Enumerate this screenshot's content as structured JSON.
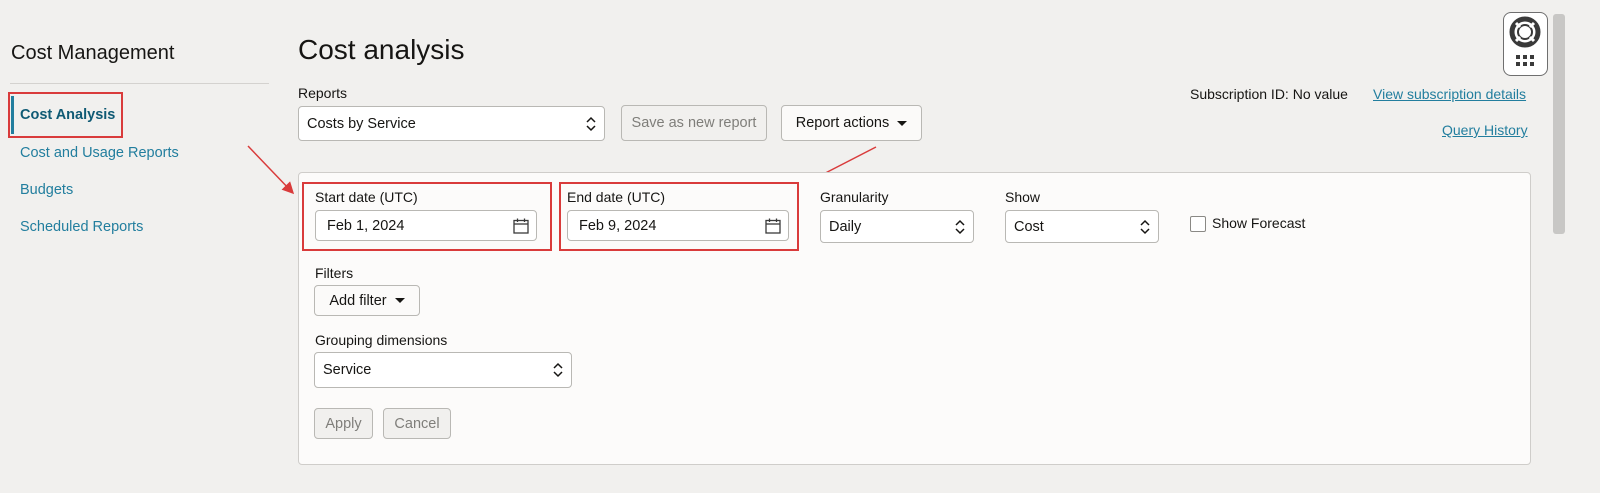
{
  "sidebar": {
    "title": "Cost Management",
    "items": [
      {
        "label": "Cost Analysis"
      },
      {
        "label": "Cost and Usage Reports"
      },
      {
        "label": "Budgets"
      },
      {
        "label": "Scheduled Reports"
      }
    ]
  },
  "header": {
    "title": "Cost analysis",
    "subscription_label": "Subscription ID: No value",
    "view_subscription_link": "View subscription details",
    "query_history_link": "Query History"
  },
  "reports": {
    "label": "Reports",
    "selected": "Costs by Service",
    "save_button": "Save as new report",
    "actions_button": "Report actions"
  },
  "filters_panel": {
    "start_date": {
      "label": "Start date (UTC)",
      "value": "Feb 1, 2024"
    },
    "end_date": {
      "label": "End date (UTC)",
      "value": "Feb 9, 2024"
    },
    "granularity": {
      "label": "Granularity",
      "value": "Daily"
    },
    "show": {
      "label": "Show",
      "value": "Cost"
    },
    "show_forecast": {
      "label": "Show Forecast",
      "checked": false
    },
    "filters": {
      "label": "Filters",
      "add_button": "Add filter"
    },
    "grouping": {
      "label": "Grouping dimensions",
      "value": "Service"
    },
    "apply_button": "Apply",
    "cancel_button": "Cancel"
  },
  "icons": {
    "calendar": "calendar-icon",
    "help": "lifebuoy-icon",
    "apps": "grid-icon"
  },
  "colors": {
    "link": "#227e9e",
    "highlight": "#d93b3b",
    "background": "#f1f0ee"
  }
}
